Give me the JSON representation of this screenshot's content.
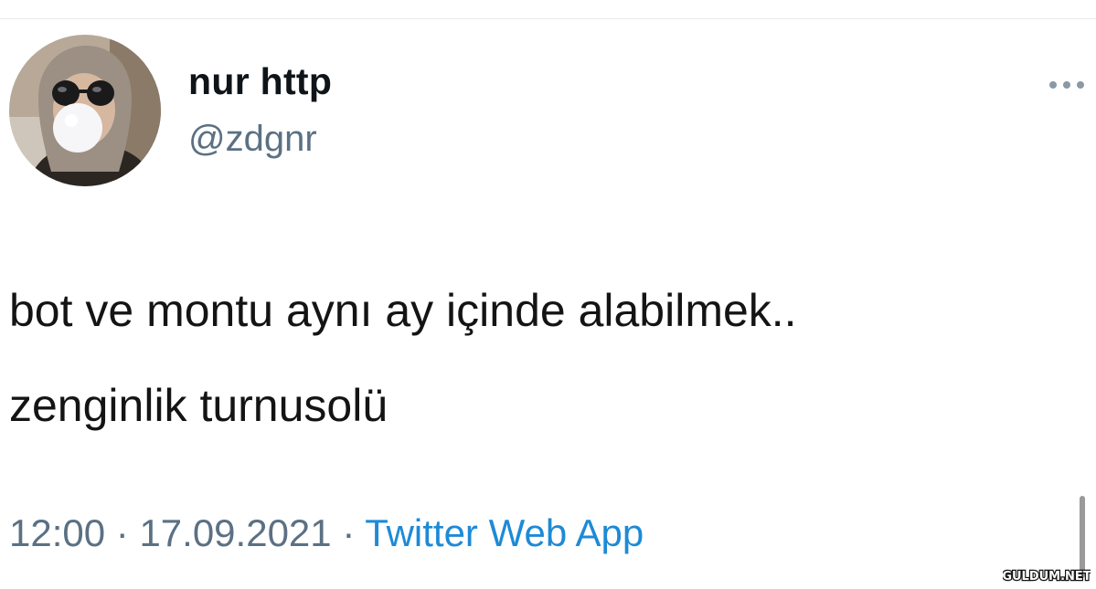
{
  "user": {
    "display_name": "nur http",
    "handle": "@zdgnr",
    "avatar_description": "profile photo of woman in headscarf and sunglasses blowing bubble gum"
  },
  "tweet": {
    "lines": [
      "bot ve montu aynı ay içinde alabilmek..",
      "zenginlik turnusolü"
    ]
  },
  "meta": {
    "time": "12:00",
    "separator": " · ",
    "date": "17.09.2021",
    "source": "Twitter Web App"
  },
  "menu": {
    "icon": "more-horizontal-icon"
  },
  "watermark": {
    "text": "GULDUM.NET"
  },
  "colors": {
    "text": "#141414",
    "secondary": "#5b7083",
    "link": "#1d8ad6"
  }
}
